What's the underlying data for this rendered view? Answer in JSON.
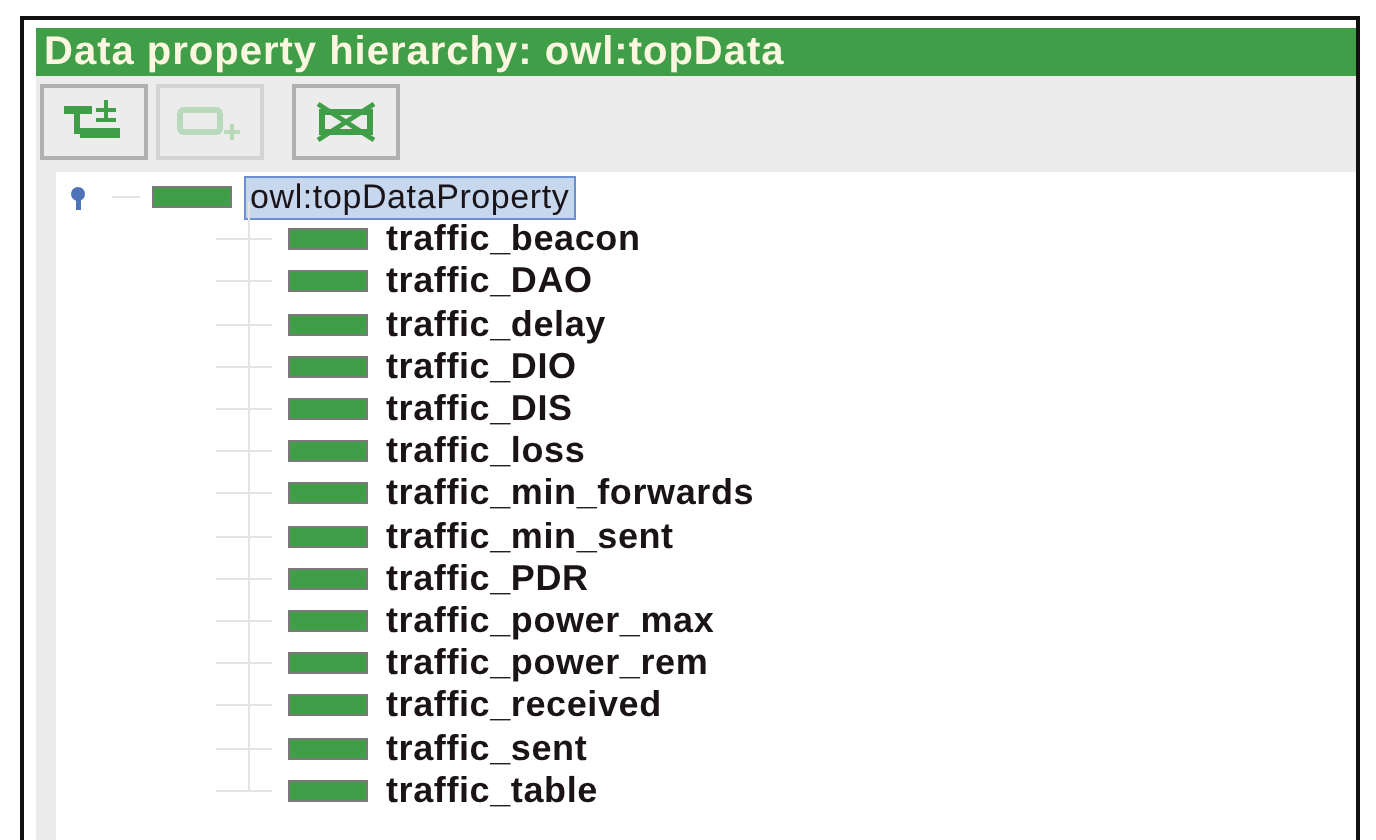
{
  "title": "Data property hierarchy: owl:topData",
  "toolbar": [
    {
      "kind": "add-sub",
      "disabled": false
    },
    {
      "kind": "add-sibling",
      "disabled": true
    },
    {
      "kind": "delete",
      "disabled": false
    }
  ],
  "tree": [
    {
      "label": "owl:topDataProperty",
      "selected": true,
      "expanded": true,
      "children": [
        {
          "label": "traffic_beacon",
          "selected": false
        },
        {
          "label": "traffic_DAO",
          "selected": false
        },
        {
          "label": "traffic_delay",
          "selected": false
        },
        {
          "label": "traffic_DIO",
          "selected": false
        },
        {
          "label": "traffic_DIS",
          "selected": false
        },
        {
          "label": "traffic_loss",
          "selected": false
        },
        {
          "label": "traffic_min_forwards",
          "selected": false
        },
        {
          "label": "traffic_min_sent",
          "selected": false
        },
        {
          "label": "traffic_PDR",
          "selected": false
        },
        {
          "label": "traffic_power_max",
          "selected": false
        },
        {
          "label": "traffic_power_rem",
          "selected": false
        },
        {
          "label": "traffic_received",
          "selected": false
        },
        {
          "label": "traffic_sent",
          "selected": false
        },
        {
          "label": "traffic_table",
          "selected": false
        }
      ]
    }
  ]
}
